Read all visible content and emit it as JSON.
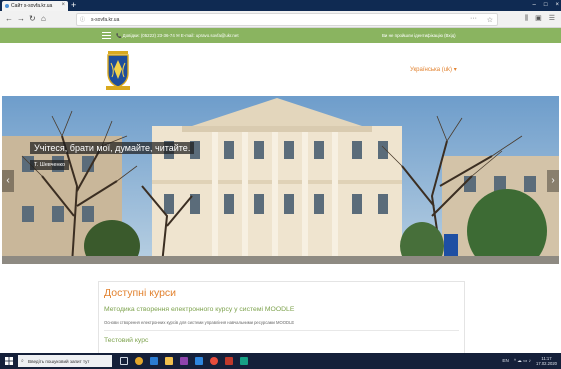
{
  "browser": {
    "tab_title": "Сайт s-sovfa.kr.ua",
    "tab_close": "×",
    "new_tab": "+",
    "window_controls": [
      "–",
      "□",
      "×"
    ],
    "nav": {
      "back": "←",
      "forward": "→",
      "reload": "↻",
      "home": "⌂"
    },
    "url": "s-sovfa.kr.ua",
    "lock": "ⓘ",
    "page_actions": "···",
    "bookmark": "☆",
    "toolbar_icons": [
      "⫼",
      "▣",
      "☰"
    ]
  },
  "site": {
    "menu_icon": "hamburger-icon",
    "contacts": "📞 Довідки: (05222) 23-36-74  ✉ E-mail: upravo.sovfa@ukr.net",
    "login": "Ви не пройшли ідентифікацію (Вхід)",
    "language": "Українська (uk) ▾",
    "colors": {
      "green": "#8ab460",
      "orange": "#e2822f",
      "link_green": "#7da24d"
    }
  },
  "hero": {
    "quote": "Учітеся, брати мої, думайте, читайте.",
    "author": "Т. Шевченко",
    "prev": "‹",
    "next": "›"
  },
  "courses": {
    "heading": "Доступні курси",
    "items": [
      {
        "title": "Методика створення електронного курсу у системі MOODLE",
        "description": "Основи створення електронних курсів для системи управління навчальними ресурсами MOODLE"
      },
      {
        "title": "Тестовий курс",
        "description": ""
      }
    ]
  },
  "taskbar": {
    "search_placeholder": "Введіть пошуковий запит тут",
    "tray_lang": "EN",
    "tray_icons": "^ ☁ ▭ ♪",
    "time": "11:17",
    "date": "17.02.2020"
  }
}
